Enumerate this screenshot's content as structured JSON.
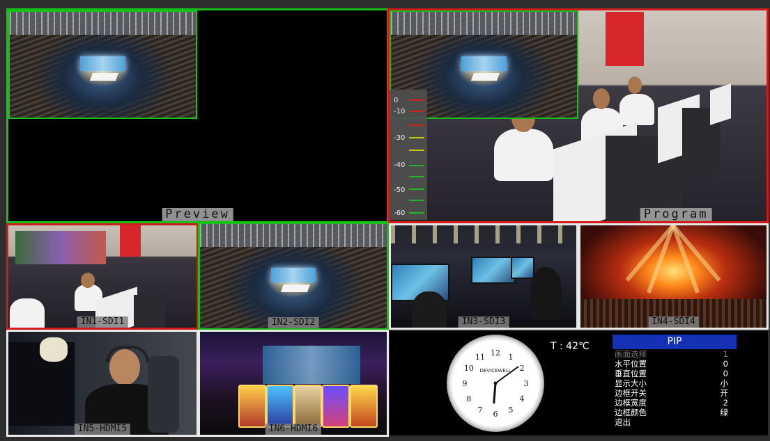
{
  "tiles": {
    "preview": {
      "label": "Preview"
    },
    "program": {
      "label": "Program"
    },
    "in1": {
      "label": "IN1-SDI1"
    },
    "in2": {
      "label": "IN2-SDI2"
    },
    "in3": {
      "label": "IN3-SDI3"
    },
    "in4": {
      "label": "IN4-SDI4"
    },
    "in5": {
      "label": "IN5-HDMI5"
    },
    "in6": {
      "label": "IN6-HDMI6"
    }
  },
  "audio_meter": {
    "ticks": [
      "0",
      "-10",
      "-30",
      "-40",
      "-50",
      "-60"
    ]
  },
  "clock": {
    "brand": "DEVICEWELL",
    "numerals": [
      "12",
      "1",
      "2",
      "3",
      "4",
      "5",
      "6",
      "7",
      "8",
      "9",
      "10",
      "11"
    ],
    "time": "6:09"
  },
  "temperature": "T : 42℃",
  "pip_menu": {
    "title": "PIP",
    "rows": [
      {
        "label": "画面选择",
        "value": "1",
        "disabled": true
      },
      {
        "label": "水平位置",
        "value": "0"
      },
      {
        "label": "垂直位置",
        "value": "0"
      },
      {
        "label": "显示大小",
        "value": "小"
      },
      {
        "label": "边框开关",
        "value": "开"
      },
      {
        "label": "边框宽度",
        "value": "2"
      },
      {
        "label": "边框颜色",
        "value": "绿"
      },
      {
        "label": "退出",
        "value": ""
      }
    ]
  },
  "colors": {
    "preview_border": "#15c21a",
    "program_border": "#d11a1a",
    "menu_header": "#1431b6"
  }
}
